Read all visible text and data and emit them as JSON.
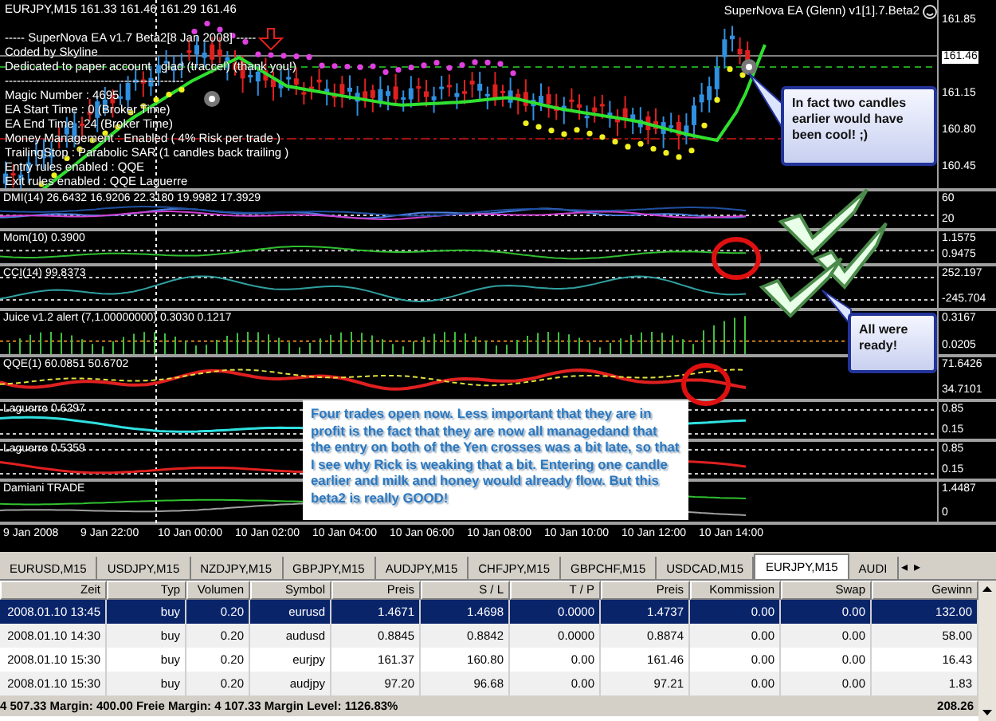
{
  "chart": {
    "symbol_line": "EURJPY,M15  161.33 161.46 161.29 161.46",
    "info_lines": [
      "----- SuperNova EA v1.7 Beta2[8 Jan 2008] -----",
      "Coded by Skyline",
      "Dedicated to paper account : glad (traccel) (thank you!)",
      "---------------------------------------------",
      "Magic Number : 4695",
      "EA Start Time : 0 (Broker Time)",
      "EA End Time : 24 (Broker Time)",
      "Money Management : Enabled ( 4% Risk per trade )",
      "TrailingStop : Parabolic SAR (1 candles back trailing )",
      "Entry rules enabled : QQE",
      "Exit rules enabled :  QQE Laguerre"
    ],
    "ea_label": "SuperNova EA (Glenn) v1[1].7.Beta2",
    "price_axis": [
      "161.85",
      "161.15",
      "160.80",
      "160.45"
    ],
    "current_price": "161.46",
    "panes": [
      {
        "kind": "dmi",
        "label": "DMI(14) 26.6432 16.9206 22.3180 19.9982 17.3929",
        "axis": [
          "60",
          "20"
        ]
      },
      {
        "kind": "momentum",
        "label": "Mom(10) 0.3900",
        "axis": [
          "1.1575",
          "0.9475"
        ]
      },
      {
        "kind": "cci",
        "label": "CCI(14) 99.8373",
        "axis": [
          "252.197",
          "-245.704"
        ]
      },
      {
        "kind": "histogram",
        "label": "Juice v1.2 alert (7,1.00000000) 0.3030 0.1217",
        "axis": [
          "0.3167",
          "0.0205"
        ]
      },
      {
        "kind": "qqe",
        "label": "QQE(1) 60.0851 50.6702",
        "axis": [
          "71.6426",
          "34.7101"
        ]
      },
      {
        "kind": "laguerre",
        "label": "Laguerre 0.6297",
        "axis": [
          "0.85",
          "0.15"
        ]
      },
      {
        "kind": "laguerre",
        "label": "Laguerre 0.5359",
        "axis": [
          "0.85",
          "0.15"
        ]
      },
      {
        "kind": "damiani",
        "label": "Damiani TRADE",
        "axis": [
          "1.4487",
          "0"
        ]
      }
    ],
    "time_axis": [
      "9 Jan 2008",
      "9 Jan 22:00",
      "10 Jan 00:00",
      "10 Jan 02:00",
      "10 Jan 04:00",
      "10 Jan 06:00",
      "10 Jan 08:00",
      "10 Jan 10:00",
      "10 Jan 12:00",
      "10 Jan 14:00"
    ]
  },
  "annotations": {
    "callouts": [
      {
        "text": "In fact two candles earlier would have been cool! ;)"
      },
      {
        "text": "All were ready!"
      }
    ],
    "note": "Four trades open now. Less important that they are in profit is the fact that they are now all managedand that the entry on both of the  Yen crosses was a bit late, so that I see why Rick is weaking that a bit. Entering one candle earlier and milk and honey would already flow. But this beta2 is really GOOD!"
  },
  "tabs": [
    {
      "label": "EURUSD,M15",
      "selected": false
    },
    {
      "label": "USDJPY,M15",
      "selected": false
    },
    {
      "label": "NZDJPY,M15",
      "selected": false
    },
    {
      "label": "GBPJPY,M15",
      "selected": false
    },
    {
      "label": "AUDJPY,M15",
      "selected": false
    },
    {
      "label": "CHFJPY,M15",
      "selected": false
    },
    {
      "label": "GBPCHF,M15",
      "selected": false
    },
    {
      "label": "USDCAD,M15",
      "selected": false
    },
    {
      "label": "EURJPY,M15",
      "selected": true
    },
    {
      "label": "AUDI",
      "selected": false
    }
  ],
  "tab_scroll": [
    "◂",
    "▸"
  ],
  "table": {
    "columns": [
      "Zeit",
      "Typ",
      "Volumen",
      "Symbol",
      "Preis",
      "S / L",
      "T / P",
      "Preis",
      "Kommission",
      "Swap",
      "Gewinn"
    ],
    "rows": [
      {
        "selected": true,
        "cells": [
          "2008.01.10 13:45",
          "buy",
          "0.20",
          "eurusd",
          "1.4671",
          "1.4698",
          "0.0000",
          "1.4737",
          "0.00",
          "0.00",
          "132.00"
        ]
      },
      {
        "selected": false,
        "cells": [
          "2008.01.10 14:30",
          "buy",
          "0.20",
          "audusd",
          "0.8845",
          "0.8842",
          "0.0000",
          "0.8874",
          "0.00",
          "0.00",
          "58.00"
        ]
      },
      {
        "selected": false,
        "cells": [
          "2008.01.10 15:30",
          "buy",
          "0.20",
          "eurjpy",
          "161.37",
          "160.80",
          "0.00",
          "161.46",
          "0.00",
          "0.00",
          "16.43"
        ]
      },
      {
        "selected": false,
        "cells": [
          "2008.01.10 15:30",
          "buy",
          "0.20",
          "audjpy",
          "97.20",
          "96.68",
          "0.00",
          "97.21",
          "0.00",
          "0.00",
          "1.83"
        ]
      }
    ]
  },
  "status_bar": {
    "summary": "4 507.33  Margin: 400.00  Freie Margin: 4 107.33  Margin Level: 1126.83%",
    "total": "208.26"
  }
}
